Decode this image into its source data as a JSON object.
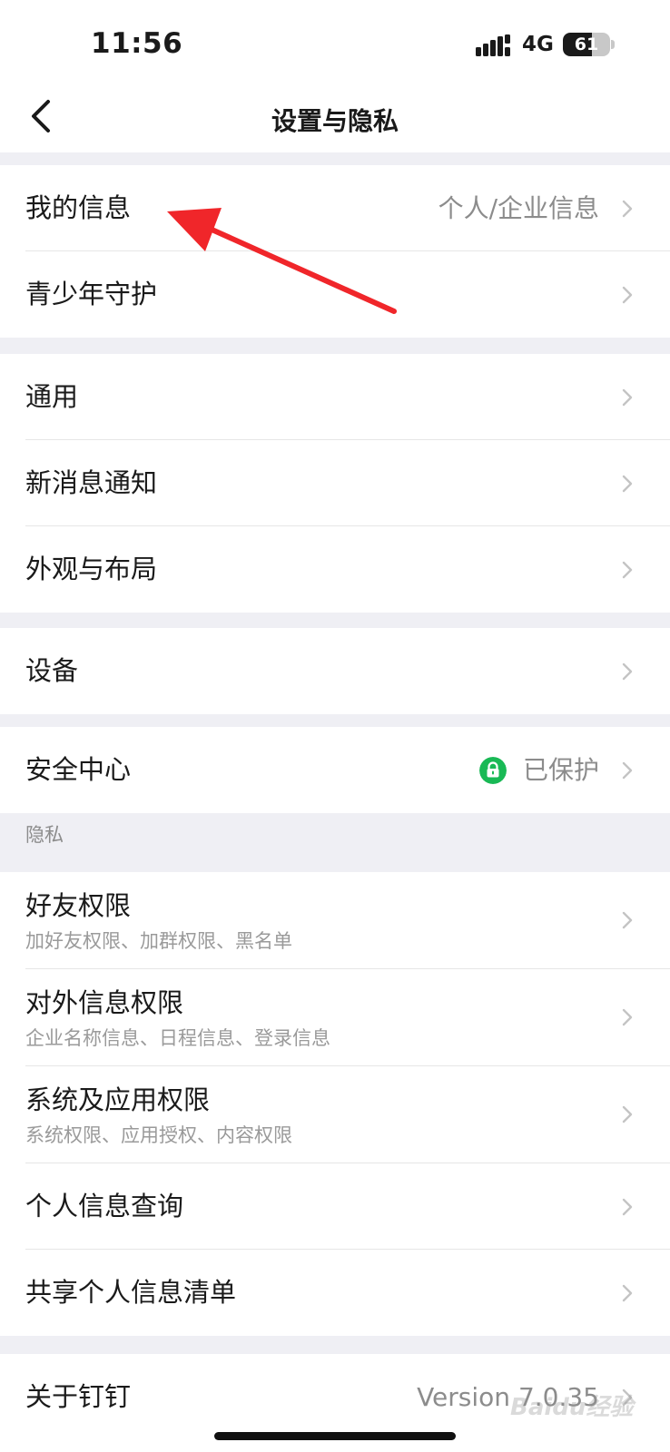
{
  "status": {
    "time": "11:56",
    "network": "4G",
    "battery": "61",
    "battery_level": 0.61
  },
  "nav": {
    "title": "设置与隐私"
  },
  "groups": {
    "profile": [
      {
        "label": "我的信息",
        "value": "个人/企业信息"
      },
      {
        "label": "青少年守护"
      }
    ],
    "general": [
      {
        "label": "通用"
      },
      {
        "label": "新消息通知"
      },
      {
        "label": "外观与布局"
      }
    ],
    "device": [
      {
        "label": "设备"
      }
    ],
    "security": [
      {
        "label": "安全中心",
        "value": "已保护"
      }
    ],
    "privacy_header": "隐私",
    "privacy": [
      {
        "label": "好友权限",
        "sub": "加好友权限、加群权限、黑名单"
      },
      {
        "label": "对外信息权限",
        "sub": "企业名称信息、日程信息、登录信息"
      },
      {
        "label": "系统及应用权限",
        "sub": "系统权限、应用授权、内容权限"
      },
      {
        "label": "个人信息查询"
      },
      {
        "label": "共享个人信息清单"
      }
    ],
    "about": [
      {
        "label": "关于钉钉",
        "value": "Version 7.0.35"
      }
    ]
  },
  "watermark": "Baidu经验",
  "colors": {
    "accent_green": "#19b955",
    "annotation_red": "#f0262a",
    "background": "#efeff4"
  }
}
